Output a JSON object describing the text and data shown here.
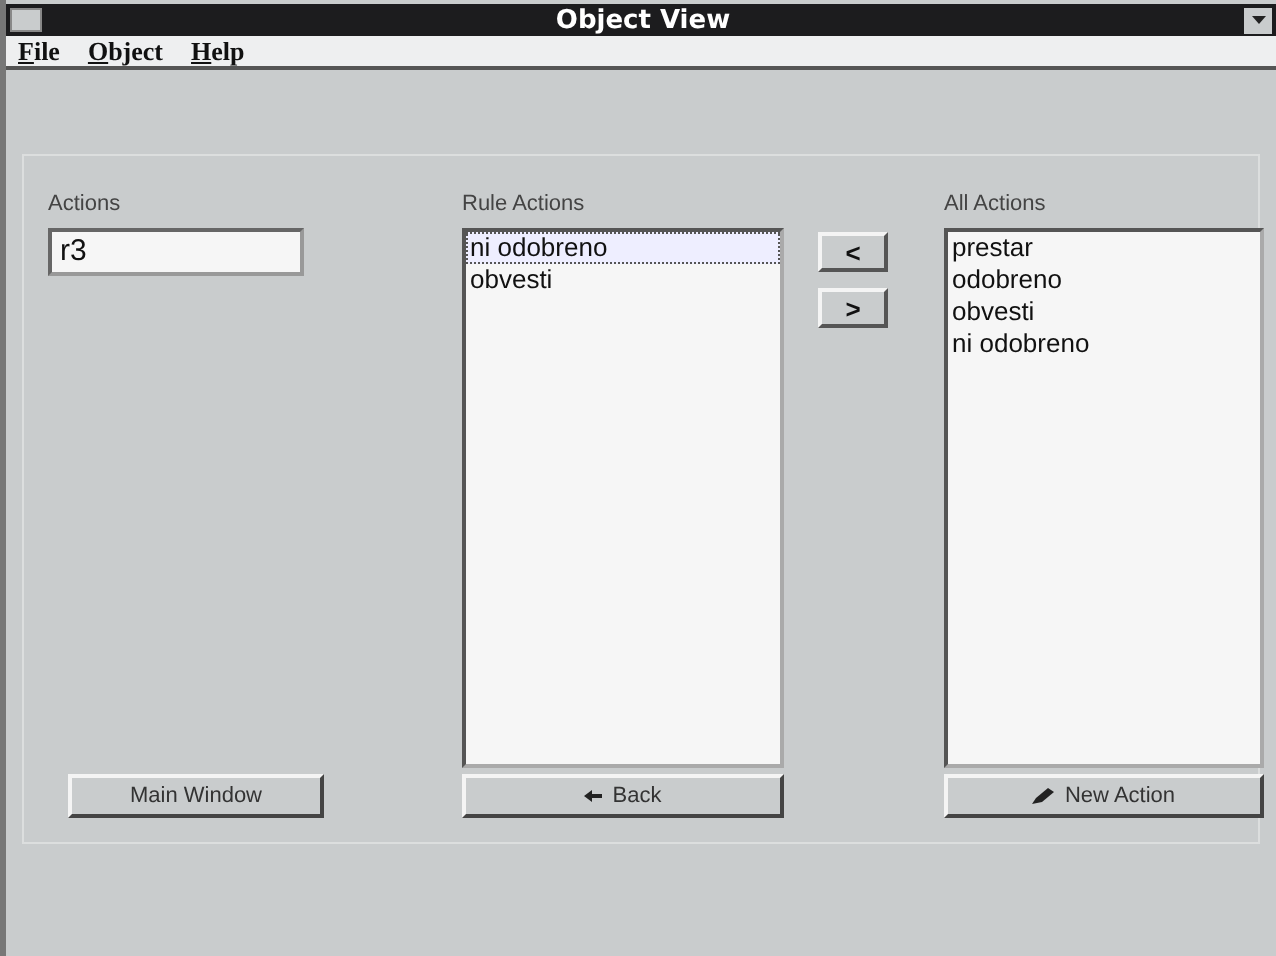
{
  "window": {
    "title": "Object View"
  },
  "menu": [
    "File",
    "Object",
    "Help"
  ],
  "actions": {
    "label": "Actions",
    "value": "r3"
  },
  "rule_actions": {
    "label": "Rule Actions",
    "items": [
      {
        "text": "ni odobreno",
        "selected": true
      },
      {
        "text": "obvesti",
        "selected": false
      }
    ]
  },
  "move_buttons": [
    "<",
    ">"
  ],
  "all_actions": {
    "label": "All Actions",
    "items": [
      {
        "text": "prestar",
        "selected": false
      },
      {
        "text": "odobreno",
        "selected": false
      },
      {
        "text": "obvesti",
        "selected": false
      },
      {
        "text": "ni odobreno",
        "selected": false
      }
    ]
  },
  "buttons": [
    {
      "label": "Main Window",
      "kind": "plain"
    },
    {
      "label": "Back",
      "kind": "back"
    },
    {
      "label": "New Action",
      "kind": "new"
    }
  ]
}
